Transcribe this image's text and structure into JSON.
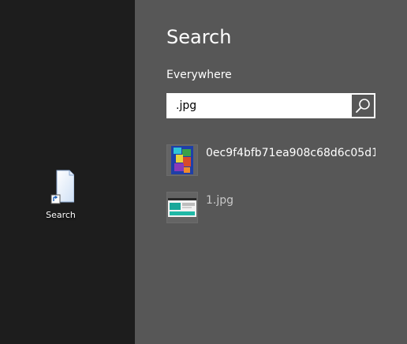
{
  "desktop": {
    "icon": {
      "label": "Search",
      "icon_name": "file-shortcut-icon"
    }
  },
  "charm": {
    "title": "Search",
    "scope": "Everywhere",
    "search": {
      "value": ".jpg"
    },
    "results": [
      {
        "label": "0ec9f4bfb71ea908c68d6c05d1...",
        "thumb": "colorful-image-thumbnail"
      },
      {
        "label": "1.jpg",
        "thumb": "webpage-screenshot-thumbnail"
      }
    ]
  },
  "colors": {
    "desktop_bg": "#1d1d1d",
    "charm_bg": "#575757",
    "text": "#ffffff"
  }
}
